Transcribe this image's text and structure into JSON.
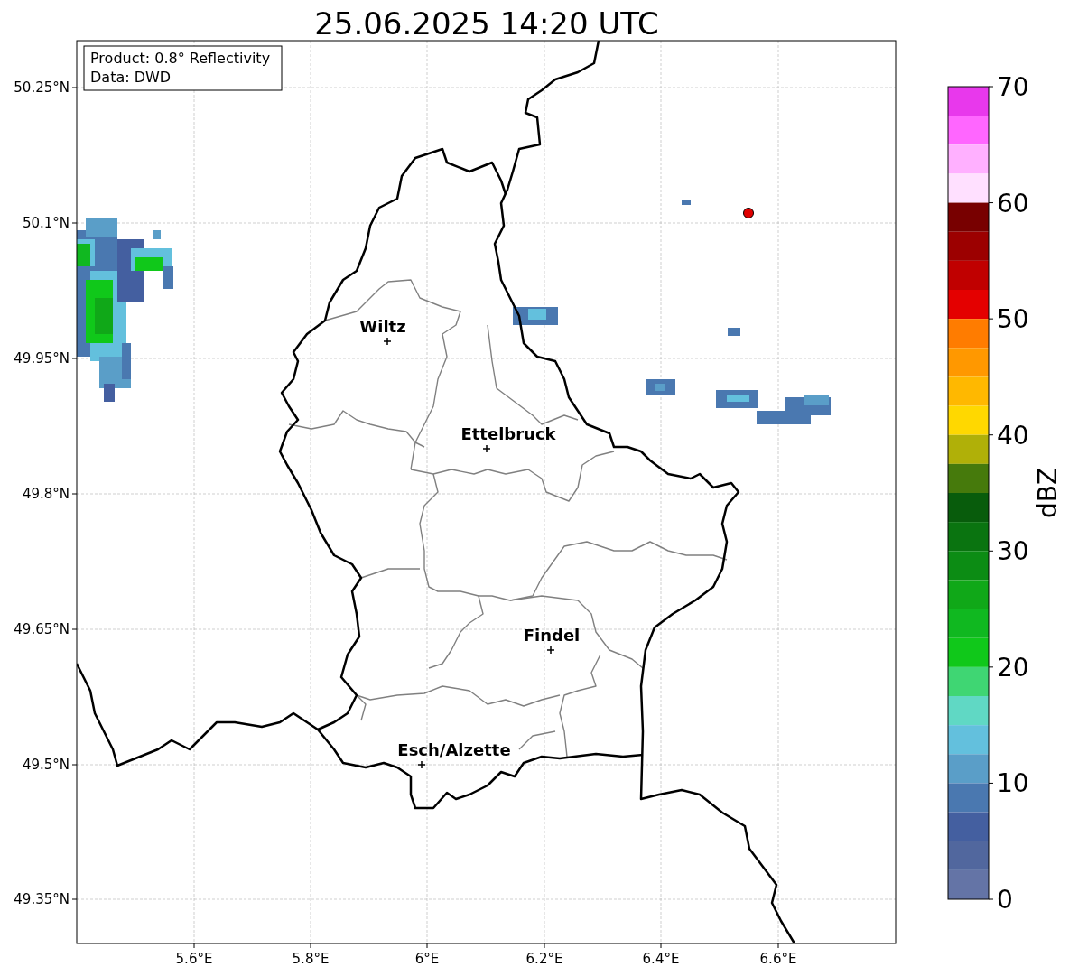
{
  "title": "25.06.2025 14:20 UTC",
  "info_box": {
    "lines": [
      "Product: 0.8° Reflectivity",
      "Data: DWD"
    ]
  },
  "y_ticks": [
    "50.25°N",
    "50.1°N",
    "49.95°N",
    "49.8°N",
    "49.65°N",
    "49.5°N",
    "49.35°N"
  ],
  "x_ticks": [
    "5.6°E",
    "5.8°E",
    "6°E",
    "6.2°E",
    "6.4°E",
    "6.6°E"
  ],
  "cities": [
    {
      "name": "Wiltz"
    },
    {
      "name": "Ettelbruck"
    },
    {
      "name": "Findel"
    },
    {
      "name": "Esch/Alzette"
    }
  ],
  "colorbar": {
    "label": "dBZ",
    "ticks": [
      "70",
      "60",
      "50",
      "40",
      "30",
      "20",
      "10",
      "0"
    ],
    "bins": [
      {
        "color": "#e838ec"
      },
      {
        "color": "#ff66ff"
      },
      {
        "color": "#ffb0ff"
      },
      {
        "color": "#ffe0ff"
      },
      {
        "color": "#780000"
      },
      {
        "color": "#9c0000"
      },
      {
        "color": "#c00000"
      },
      {
        "color": "#e40000"
      },
      {
        "color": "#ff7c00"
      },
      {
        "color": "#ff9800"
      },
      {
        "color": "#ffb800"
      },
      {
        "color": "#ffd800"
      },
      {
        "color": "#b0b008"
      },
      {
        "color": "#467a0c"
      },
      {
        "color": "#085c0c"
      },
      {
        "color": "#0a7410"
      },
      {
        "color": "#0c8c14"
      },
      {
        "color": "#10a818"
      },
      {
        "color": "#10b820"
      },
      {
        "color": "#10c81a"
      },
      {
        "color": "#3fd673"
      },
      {
        "color": "#60d8c4"
      },
      {
        "color": "#63c0dd"
      },
      {
        "color": "#5a9ec8"
      },
      {
        "color": "#4a78b0"
      },
      {
        "color": "#445fa0"
      },
      {
        "color": "#51679e"
      },
      {
        "color": "#6474a6"
      }
    ]
  }
}
